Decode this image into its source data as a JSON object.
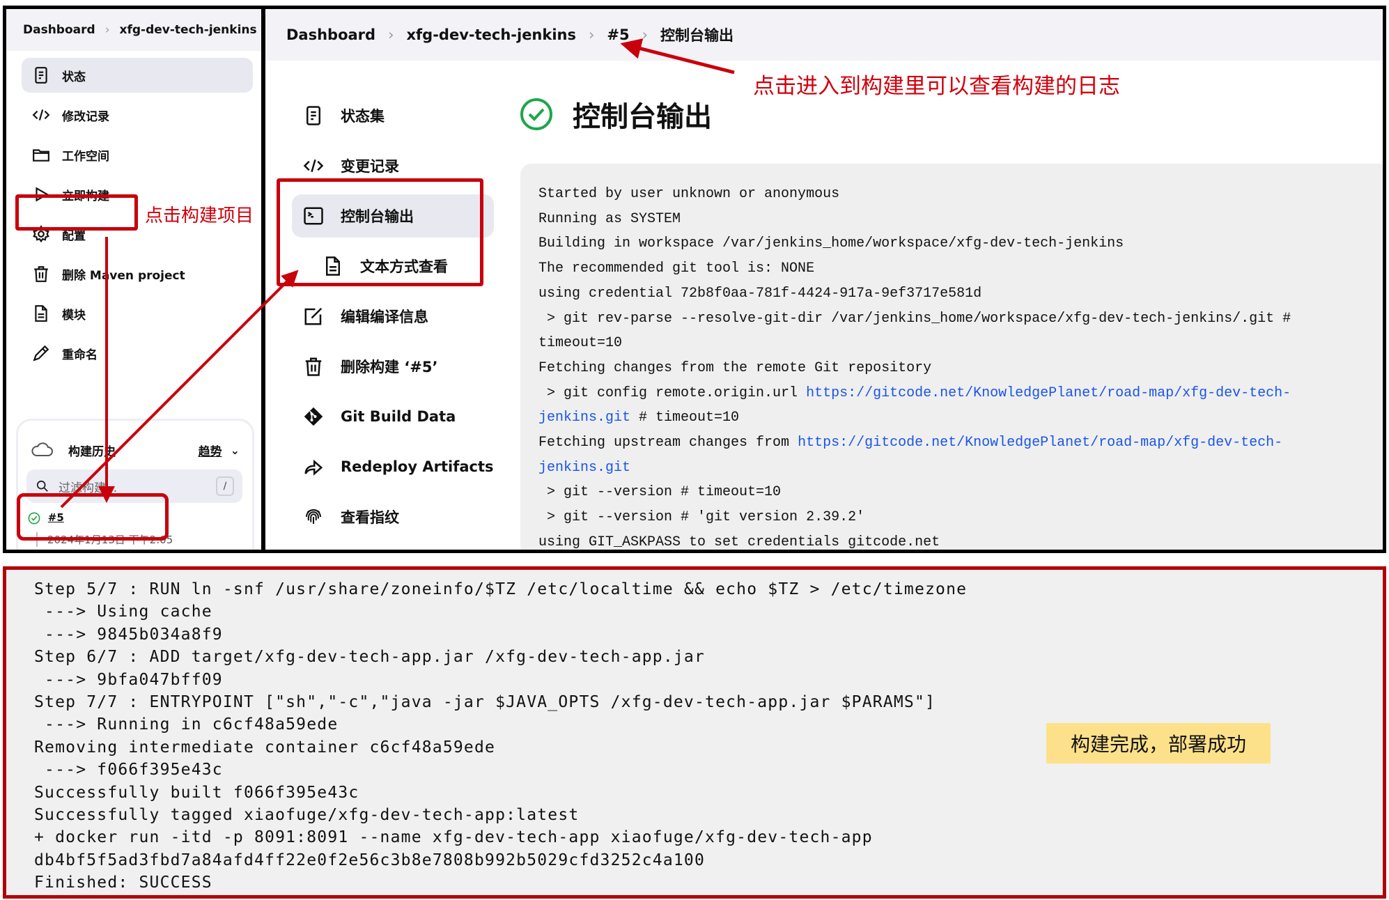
{
  "left_panel": {
    "breadcrumb": [
      "Dashboard",
      "xfg-dev-tech-jenkins"
    ],
    "sidebar": [
      {
        "label": "状态",
        "icon": "document-icon",
        "active": true
      },
      {
        "label": "修改记录",
        "icon": "code-icon"
      },
      {
        "label": "工作空间",
        "icon": "folder-icon"
      },
      {
        "label": "立即构建",
        "icon": "play-icon"
      },
      {
        "label": "配置",
        "icon": "gear-icon"
      },
      {
        "label": "删除 Maven project",
        "icon": "trash-icon"
      },
      {
        "label": "模块",
        "icon": "file-icon"
      },
      {
        "label": "重命名",
        "icon": "pencil-icon"
      }
    ],
    "build_history": {
      "title": "构建历史",
      "trend_label": "趋势",
      "filter_placeholder": "过滤构建...",
      "shortcut_key": "/",
      "builds": [
        {
          "number": "#5",
          "date": "2024年1月13日 下午2:05",
          "status": "success"
        }
      ]
    }
  },
  "right_panel": {
    "breadcrumb": [
      "Dashboard",
      "xfg-dev-tech-jenkins",
      "#5",
      "控制台输出"
    ],
    "menu": [
      {
        "label": "状态集",
        "icon": "document-icon"
      },
      {
        "label": "变更记录",
        "icon": "code-icon"
      },
      {
        "label": "控制台输出",
        "icon": "terminal-icon",
        "active": true
      },
      {
        "label": "文本方式查看",
        "icon": "file-icon",
        "sub": true
      },
      {
        "label": "编辑编译信息",
        "icon": "edit-icon"
      },
      {
        "label": "删除构建 ‘#5’",
        "icon": "trash-icon"
      },
      {
        "label": "Git Build Data",
        "icon": "git-icon"
      },
      {
        "label": "Redeploy Artifacts",
        "icon": "redeploy-icon"
      },
      {
        "label": "查看指纹",
        "icon": "fingerprint-icon"
      }
    ],
    "page_title": "控制台输出",
    "console_lines": [
      {
        "text": "Started by user unknown or anonymous"
      },
      {
        "text": "Running as SYSTEM"
      },
      {
        "text": "Building in workspace /var/jenkins_home/workspace/xfg-dev-tech-jenkins"
      },
      {
        "text": "The recommended git tool is: NONE"
      },
      {
        "text": "using credential 72b8f0aa-781f-4424-917a-9ef3717e581d"
      },
      {
        "text": " > git rev-parse --resolve-git-dir /var/jenkins_home/workspace/xfg-dev-tech-jenkins/.git #"
      },
      {
        "text": "timeout=10"
      },
      {
        "text": "Fetching changes from the remote Git repository"
      },
      {
        "text": " > git config remote.origin.url ",
        "link": "https://gitcode.net/KnowledgePlanet/road-map/xfg-dev-tech-"
      },
      {
        "link": "jenkins.git",
        "text_after": " # timeout=10"
      },
      {
        "text": "Fetching upstream changes from ",
        "link": "https://gitcode.net/KnowledgePlanet/road-map/xfg-dev-tech-"
      },
      {
        "link": "jenkins.git"
      },
      {
        "text": " > git --version # timeout=10"
      },
      {
        "text": " > git --version # 'git version 2.39.2'"
      },
      {
        "text": "using GIT_ASKPASS to set credentials gitcode.net"
      }
    ]
  },
  "terminal_output": [
    "Step 5/7 : RUN ln -snf /usr/share/zoneinfo/$TZ /etc/localtime && echo $TZ > /etc/timezone",
    " ---> Using cache",
    " ---> 9845b034a8f9",
    "Step 6/7 : ADD target/xfg-dev-tech-app.jar /xfg-dev-tech-app.jar",
    " ---> 9bfa047bff09",
    "Step 7/7 : ENTRYPOINT [\"sh\",\"-c\",\"java -jar $JAVA_OPTS /xfg-dev-tech-app.jar $PARAMS\"]",
    " ---> Running in c6cf48a59ede",
    "Removing intermediate container c6cf48a59ede",
    " ---> f066f395e43c",
    "Successfully built f066f395e43c",
    "Successfully tagged xiaofuge/xfg-dev-tech-app:latest",
    "+ docker run -itd -p 8091:8091 --name xfg-dev-tech-app xiaofuge/xfg-dev-tech-app",
    "db4bf5f5ad3fbd7a84afd4ff22e0f2e56c3b8e7808b992b5029cfd3252c4a100",
    "Finished: SUCCESS"
  ],
  "annotations": {
    "click_build": "点击构建项目",
    "view_log": "点击进入到构建里可以查看构建的日志",
    "result_note": "构建完成，部署成功"
  },
  "colors": {
    "annotation_red": "#c8000c",
    "success_green": "#1ea64b",
    "link_blue": "#1a55e8",
    "note_yellow": "#fde18a"
  }
}
